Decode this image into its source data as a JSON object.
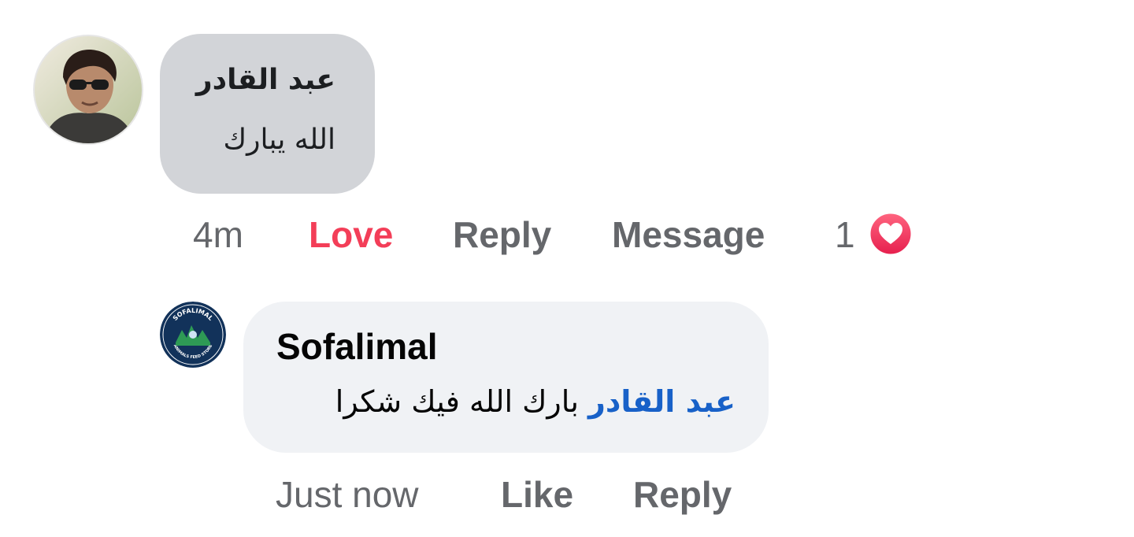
{
  "comment": {
    "author": "عبد القادر",
    "text": "الله يبارك",
    "time": "4m",
    "reaction_label": "Love",
    "reply_label": "Reply",
    "message_label": "Message",
    "reaction_count": "1",
    "reaction_icon": "heart-icon",
    "reaction_color": "#f33e58"
  },
  "reply": {
    "author": "Sofalimal",
    "mention": "عبد القادر",
    "text": "بارك الله فيك شكرا",
    "time": "Just now",
    "like_label": "Like",
    "reply_label": "Reply",
    "avatar_logo": {
      "top_text": "SOFALIMAL",
      "bottom_text": "ANIMALS FEED STORE"
    },
    "mention_color": "#1861c8"
  }
}
